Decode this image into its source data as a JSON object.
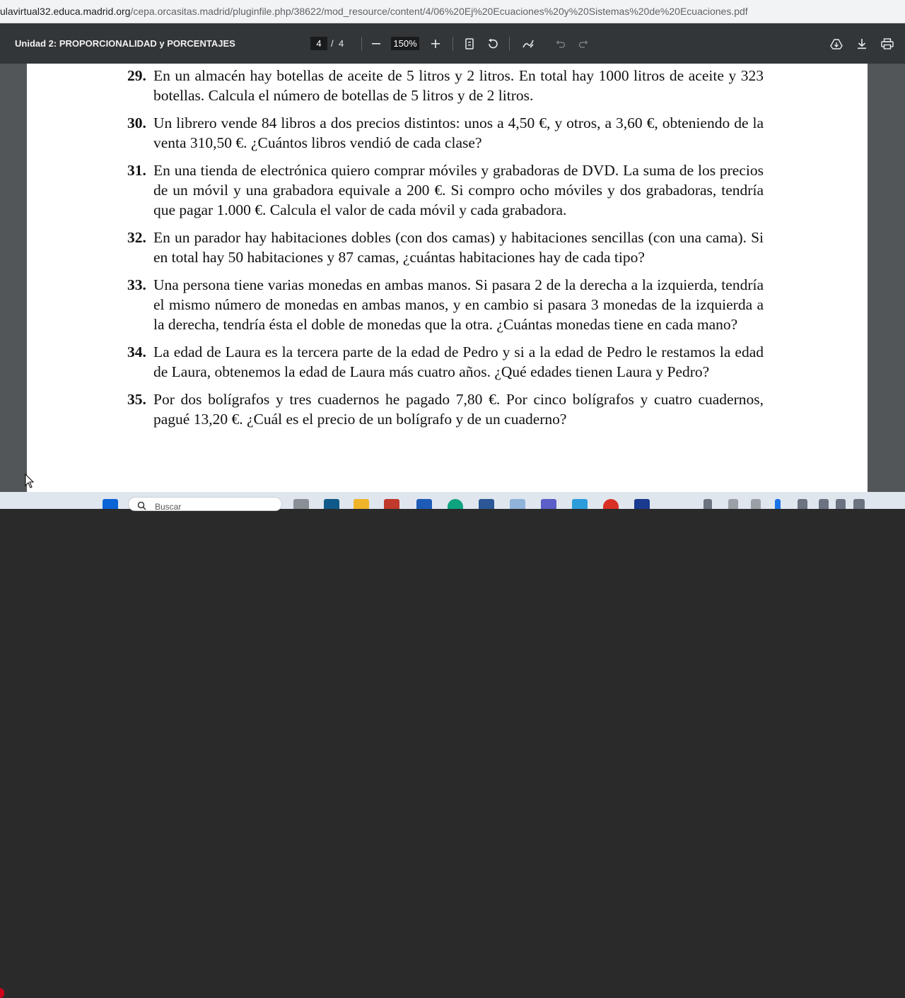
{
  "browser": {
    "url_host": "ulavirtual32.educa.madrid.org",
    "url_path": "/cepa.orcasitas.madrid/pluginfile.php/38622/mod_resource/content/4/06%20Ej%20Ecuaciones%20y%20Sistemas%20de%20Ecuaciones.pdf"
  },
  "viewer": {
    "title": "Unidad 2: PROPORCIONALIDAD y PORCENTAJES",
    "current_page": "4",
    "page_separator": "/",
    "total_pages": "4",
    "zoom": "150%",
    "zoom_out_icon": "minus-icon",
    "zoom_in_icon": "plus-icon",
    "fit_icon": "fit-page-icon",
    "rotate_icon": "rotate-icon",
    "annotate_icon": "draw-icon",
    "undo_icon": "undo-icon",
    "redo_icon": "redo-icon",
    "save_icon": "drive-icon",
    "download_icon": "download-icon",
    "print_icon": "print-icon"
  },
  "exercises": [
    {
      "num": "29.",
      "text": "En un almacén hay botellas de aceite de 5 litros y 2 litros. En total hay 1000 litros de aceite y 323 botellas. Calcula el número de botellas de 5 litros y de 2 litros."
    },
    {
      "num": "30.",
      "text": "Un librero vende 84 libros a dos precios distintos: unos a 4,50 €, y otros, a 3,60 €, obteniendo de la venta 310,50 €. ¿Cuántos libros vendió de cada clase?"
    },
    {
      "num": "31.",
      "text": "En una tienda de electrónica quiero comprar móviles y grabadoras de DVD. La suma de los precios de un móvil y una grabadora equivale a 200 €. Si compro ocho móviles y dos grabadoras, tendría que pagar 1.000 €. Calcula el valor de cada móvil y cada grabadora."
    },
    {
      "num": "32.",
      "text": "En un parador hay habitaciones dobles (con dos camas) y habitaciones sencillas (con una cama). Si en total hay 50 habitaciones y 87 camas, ¿cuántas habitaciones hay de cada tipo?"
    },
    {
      "num": "33.",
      "text": "Una persona tiene varias monedas en ambas manos. Si pasara 2 de la derecha a la izquierda, tendría el mismo número de monedas en ambas manos, y en cambio si pasara 3 monedas de la izquierda a la derecha, tendría ésta el doble de monedas que la otra. ¿Cuántas monedas tiene en cada mano?"
    },
    {
      "num": "34.",
      "text": "La edad de Laura es la tercera parte de la edad de Pedro y si a la edad de Pedro le restamos la edad de Laura, obtenemos la edad de Laura más cuatro años. ¿Qué edades tienen Laura y Pedro?"
    },
    {
      "num": "35.",
      "text": "Por dos bolígrafos y tres cuadernos he pagado 7,80 €. Por cinco bolígrafos y cuatro cuadernos, pagué 13,20 €. ¿Cuál es el precio de un bolígrafo y de un cuaderno?"
    }
  ],
  "taskbar": {
    "search_placeholder": "Buscar",
    "icons": [
      "start-icon",
      "search-icon",
      "task-view-icon",
      "widgets-icon",
      "file-explorer-icon",
      "notepad-icon",
      "app-icon",
      "edge-icon",
      "word-icon",
      "monitor-icon",
      "teams-icon",
      "onenote-icon",
      "chrome-icon",
      "app-icon-2"
    ]
  }
}
